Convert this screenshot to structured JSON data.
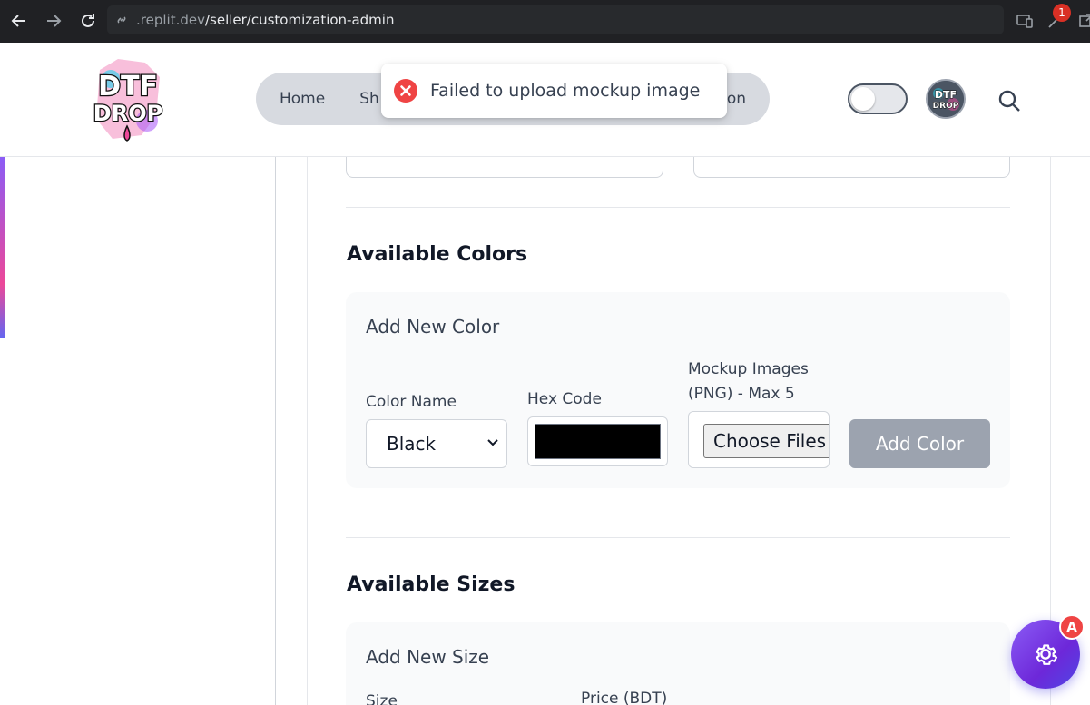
{
  "browser": {
    "url_domain": ".replit.dev",
    "url_path": "/seller/customization-admin",
    "extension_badge": "1"
  },
  "header": {
    "logo_text": "DTF DROP",
    "nav": [
      {
        "label": "Home"
      },
      {
        "label": "Sh"
      },
      {
        "label": "on"
      }
    ],
    "theme_toggle_on": false,
    "avatar_text": "DTF DROP"
  },
  "toast": {
    "message": "Failed to upload mockup image",
    "type": "error"
  },
  "colors_section": {
    "title": "Available Colors",
    "panel_title": "Add New Color",
    "color_name_label": "Color Name",
    "color_name_value": "Black",
    "hex_code_label": "Hex Code",
    "hex_value": "#000000",
    "mockup_label_line1": "Mockup Images",
    "mockup_label_line2": "(PNG) - Max 5",
    "choose_files_label": "Choose Files",
    "add_button_label": "Add Color"
  },
  "sizes_section": {
    "title": "Available Sizes",
    "panel_title": "Add New Size",
    "size_label": "Size",
    "price_label": "Price (BDT)"
  },
  "fab": {
    "badge": "A",
    "accent": "#7c3aed"
  }
}
